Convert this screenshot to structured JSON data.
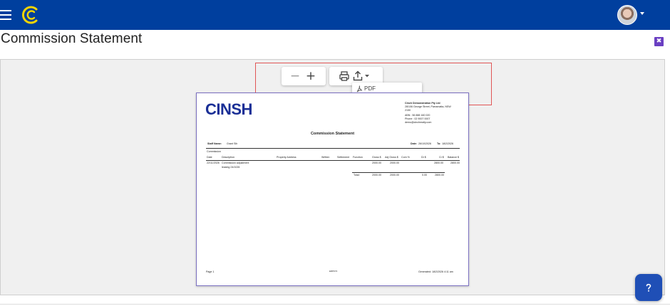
{
  "page": {
    "title": "Commission Statement"
  },
  "topbar": {
    "menu_icon": "hamburger-icon",
    "logo_icon": "brand-logo-icon",
    "avatar_icon": "user-avatar"
  },
  "viewer": {
    "zoom_out_label": "−",
    "zoom_in_label": "+",
    "export_menu": {
      "items": [
        {
          "label": "PDF",
          "icon": "pdf-icon"
        }
      ]
    }
  },
  "report": {
    "brand": "CINSH",
    "company": {
      "name": "Cinch Demonstration Pty Ltd",
      "address1": "28/106 George Street, Parramatta, NSW",
      "address2": "2150",
      "abn": "ABN : 56 888 160 020",
      "phone": "Phone : 02 9007 0007",
      "email": "demo@cinchrealty.com"
    },
    "title": "Commission Statement",
    "staff_label": "Staff Name:",
    "staff_value": "Grant Sih",
    "date_label": "Date:",
    "date_from": "26/10/2026",
    "date_to_label": "To:",
    "date_to": "18/2/2026",
    "section": "Commission",
    "columns": [
      "Date",
      "Description",
      "Property Address",
      "Written",
      "Settlement",
      "Function",
      "Gross $",
      "Adj Gross $",
      "Com %",
      "Dr $",
      "Cr $",
      "Balance $"
    ],
    "row": {
      "date": "22/11/2026",
      "description": "Commission adjustment",
      "description2": "leasing 24/1026",
      "gross": "2000.00",
      "adj_gross": "2000.00",
      "cr": "2800.00",
      "balance": "2800.00"
    },
    "totals": {
      "label": "Total:",
      "gross": "2000.00",
      "adj_gross": "2000.00",
      "dr": "0.00",
      "cr": "2800.00"
    },
    "footer": {
      "page": "Page 1",
      "center": "ERP074",
      "generated": "Generated: 18/2/2026 4:11 am"
    }
  },
  "help": {
    "icon": "help-icon"
  }
}
